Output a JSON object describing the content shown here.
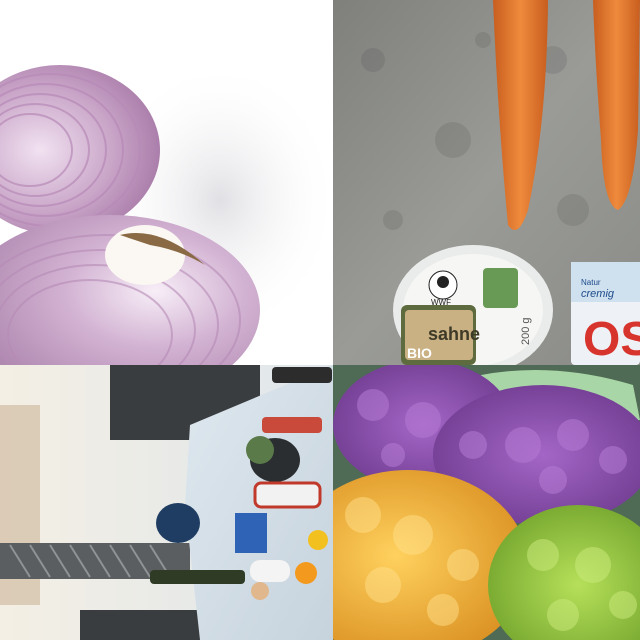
{
  "panels": {
    "top_left": {
      "subject": "red-onion"
    },
    "top_right": {
      "subject": "carrots-and-packages",
      "sahne_tub": {
        "brand": "BIO",
        "name": "sahne",
        "badge": "WWF",
        "weight": "200 g"
      },
      "package": {
        "line1": "Natur",
        "line2": "cremig",
        "big": "OS"
      }
    },
    "bottom_left": {
      "subject": "patio-table-items"
    },
    "bottom_right": {
      "subject": "colored-cauliflower"
    }
  },
  "colors": {
    "onion": "#c9a6c6",
    "carrot": "#e07a2f",
    "purple_cauliflower": "#8e4fb0",
    "orange_cauliflower": "#f0b23a",
    "green_cauliflower": "#93c63b"
  }
}
